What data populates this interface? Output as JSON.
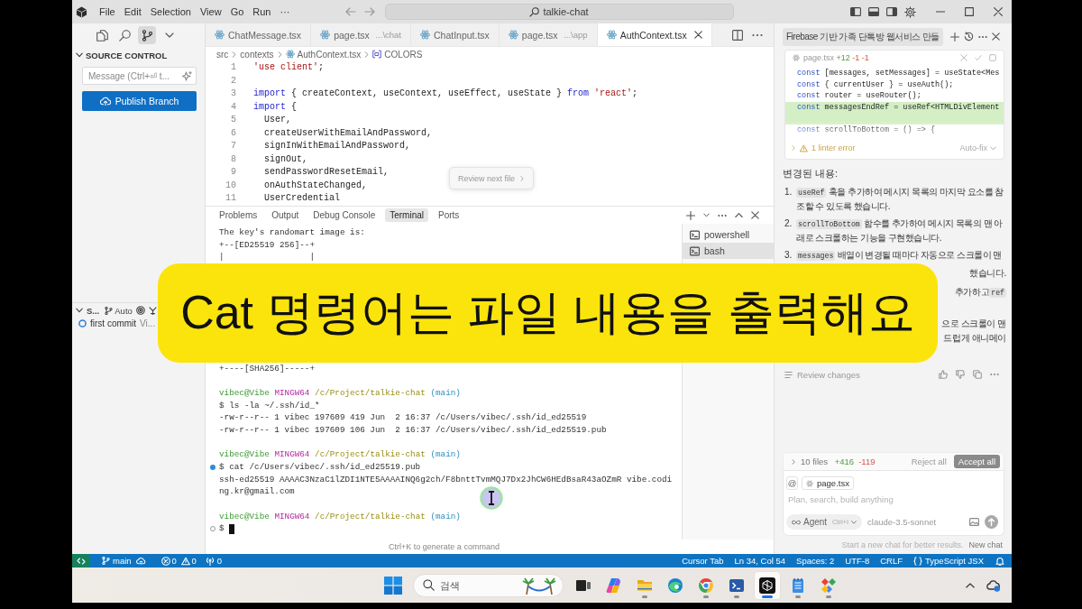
{
  "title_bar": {
    "menus": [
      "File",
      "Edit",
      "Selection",
      "View",
      "Go",
      "Run",
      "···"
    ],
    "search": "talkie-chat"
  },
  "sidebar": {
    "views": [
      {
        "kind": "explorer",
        "selected": false
      },
      {
        "kind": "search",
        "selected": false
      },
      {
        "kind": "source_control",
        "selected": true
      },
      {
        "kind": "more",
        "selected": false
      }
    ],
    "section_title": "SOURCE CONTROL",
    "message": {
      "placeholder": "Message (Ctrl+⏎ t..."
    },
    "publish_button": "Publish Branch",
    "graph": {
      "title": "S...",
      "mode": "Auto",
      "commits": [
        {
          "message": "first commit",
          "author": "Vi..."
        }
      ]
    }
  },
  "editor": {
    "tabs": [
      {
        "label": "ChatMessage.tsx",
        "selected": false
      },
      {
        "label": "page.tsx",
        "detail": "...\\chat",
        "selected": false
      },
      {
        "label": "ChatInput.tsx",
        "selected": false
      },
      {
        "label": "page.tsx",
        "detail": "...\\app",
        "selected": false
      },
      {
        "label": "AuthContext.tsx",
        "selected": true
      }
    ],
    "breadcrumb": [
      {
        "label": "src",
        "kind": "folder"
      },
      {
        "label": "contexts",
        "kind": "folder"
      },
      {
        "label": "AuthContext.tsx",
        "kind": "file"
      },
      {
        "label": "COLORS",
        "kind": "symbol"
      }
    ],
    "lines": [
      {
        "number": "1",
        "tokens": [
          {
            "kind": "string",
            "text": "'use client'"
          },
          {
            "kind": "plain",
            "text": ";"
          }
        ]
      },
      {
        "number": "2"
      },
      {
        "number": "3",
        "tokens": [
          {
            "kind": "keyword",
            "text": "import"
          },
          {
            "kind": "plain",
            "text": " { createContext, useContext, useEffect, useState } "
          },
          {
            "kind": "keyword",
            "text": "from"
          },
          {
            "kind": "string",
            "text": " 'react'"
          },
          {
            "kind": "plain",
            "text": ";"
          }
        ]
      },
      {
        "number": "4",
        "tokens": [
          {
            "kind": "keyword",
            "text": "import"
          },
          {
            "kind": "plain",
            "text": " {"
          }
        ]
      },
      {
        "number": "5",
        "tokens": [
          {
            "kind": "plain",
            "text": "  User,"
          }
        ]
      },
      {
        "number": "6",
        "tokens": [
          {
            "kind": "plain",
            "text": "  createUserWithEmailAndPassword,"
          }
        ]
      },
      {
        "number": "7",
        "tokens": [
          {
            "kind": "plain",
            "text": "  signInWithEmailAndPassword,"
          }
        ]
      },
      {
        "number": "8",
        "tokens": [
          {
            "kind": "plain",
            "text": "  signOut,"
          }
        ]
      },
      {
        "number": "9",
        "tokens": [
          {
            "kind": "plain",
            "text": "  sendPasswordResetEmail,"
          }
        ]
      },
      {
        "number": "10",
        "tokens": [
          {
            "kind": "plain",
            "text": "  onAuthStateChanged,"
          }
        ]
      },
      {
        "number": "11",
        "tokens": [
          {
            "kind": "plain",
            "text": "  UserCredential"
          }
        ]
      }
    ],
    "review_button": "Review next file"
  },
  "panel": {
    "tabs": [
      {
        "label": "Problems",
        "selected": false
      },
      {
        "label": "Output",
        "selected": false
      },
      {
        "label": "Debug Console",
        "selected": false
      },
      {
        "label": "Terminal",
        "selected": true
      },
      {
        "label": "Ports",
        "selected": false
      }
    ],
    "terminal": {
      "randomart": {
        "header": "The key's randomart image is:",
        "top": "+--[ED25519 256]--+",
        "rows": [
          "|                 |"
        ],
        "bottom": "+----[SHA256]-----+"
      },
      "sessions": [
        {
          "kind": "unmarked",
          "prompt": {
            "user": "vibec@Vibe",
            "shell": "MINGW64",
            "path": "/c/Project/talkie-chat",
            "branch": "(main)"
          },
          "command": "$ ls -la ~/.ssh/id_*",
          "output": [
            "-rw-r--r-- 1 vibec 197609 419 Jun  2 16:37 /c/Users/vibec/.ssh/id_ed25519",
            "-rw-r--r-- 1 vibec 197609 106 Jun  2 16:37 /c/Users/vibec/.ssh/id_ed25519.pub"
          ]
        },
        {
          "kind": "succeeded",
          "prompt": {
            "user": "vibec@Vibe",
            "shell": "MINGW64",
            "path": "/c/Project/talkie-chat",
            "branch": "(main)"
          },
          "command": "$ cat /c/Users/vibec/.ssh/id_ed25519.pub",
          "output": [
            "ssh-ed25519 AAAAC3NzaC1lZDI1NTE5AAAAINQ6g2ch/F8bnttTvmMQJ7Dx2JhCW6HEdBsaR43aOZmR vibe.codi",
            "ng.kr@gmail.com"
          ]
        },
        {
          "kind": "active",
          "prompt": {
            "user": "vibec@Vibe",
            "shell": "MINGW64",
            "path": "/c/Project/talkie-chat",
            "branch": "(main)"
          },
          "command": "$",
          "cursor": true
        }
      ]
    },
    "terminals": [
      {
        "label": "powershell",
        "selected": false
      },
      {
        "label": "bash",
        "selected": true
      }
    ],
    "hint": "Ctrl+K to generate a command"
  },
  "chat": {
    "title": "Firebase 기반 가족 단톡방 웹서비스 만들",
    "diff": {
      "file": "page.tsx",
      "stats": [
        {
          "kind": "added",
          "text": "+12"
        },
        {
          "kind": "removed",
          "text": "-1"
        },
        {
          "kind": "removed",
          "text": "-1"
        }
      ],
      "lines": [
        {
          "added": false,
          "tokens": [
            {
              "kind": "keyword",
              "text": "const"
            },
            {
              "kind": "plain",
              "text": " [messages, setMessages] = useState<Mes"
            }
          ]
        },
        {
          "added": false,
          "tokens": [
            {
              "kind": "keyword",
              "text": "const"
            },
            {
              "kind": "plain",
              "text": " { currentUser } = useAuth();"
            }
          ]
        },
        {
          "added": false,
          "tokens": [
            {
              "kind": "keyword",
              "text": "const"
            },
            {
              "kind": "plain",
              "text": " router = useRouter();"
            }
          ]
        },
        {
          "added": true,
          "tokens": [
            {
              "kind": "keyword",
              "text": "const"
            },
            {
              "kind": "plain",
              "text": " messagesEndRef = useRef<HTMLDivElement"
            }
          ]
        },
        {
          "added": false,
          "tokens": [
            {
              "kind": "keyword",
              "text": "const"
            },
            {
              "kind": "plain",
              "text": " scrollToBottom = () => {"
            }
          ]
        }
      ],
      "lint": "1 linter error",
      "fix": "Auto-fix"
    },
    "heading": "변경된 내용:",
    "items": [
      {
        "number": "1.",
        "code": "useRef",
        "text": "훅을 추가하여 메시지 목록의 마지막 요소를 참조할 수 있도록 했습니다."
      },
      {
        "number": "2.",
        "code": "scrollToBottom",
        "text": "함수를 추가하여 메시지 목록의 맨 아래로 스크롤하는 기능을 구현했습니다."
      },
      {
        "number": "3.",
        "code": "messages",
        "text": "배열이 변경될 때마다 자동으로 스크롤이 맨"
      }
    ],
    "partial_lines": [
      {
        "text": "했습니다."
      },
      {
        "text": "추가하고",
        "code": "ref"
      },
      {
        "text": "으로 스크롤이 맨"
      },
      {
        "text": "드럽게 애니메이"
      }
    ],
    "review": "Review changes",
    "summary": {
      "files": "10 files",
      "added": "+416",
      "removed": "-119"
    },
    "reject": "Reject all",
    "accept": "Accept all",
    "mention": "@",
    "context_file": "page.tsx",
    "input": {
      "placeholder": "Plan, search, build anything"
    },
    "mode": "Agent",
    "shortcut": "Ctrl+I",
    "model": "claude-3.5-sonnet",
    "footer": "Start a new chat for better results.",
    "new_chat": "New chat"
  },
  "status_bar": {
    "branch": "main",
    "errors": "0",
    "warnings": "0",
    "ports": "0",
    "items": [
      "Cursor Tab",
      "Ln 34, Col 54",
      "Spaces: 2",
      "UTF-8",
      "CRLF"
    ],
    "language": "TypeScript JSX"
  },
  "taskbar": {
    "search": {
      "placeholder": "검색"
    },
    "apps": [
      {
        "kind": "task_view",
        "running": false,
        "selected": false
      },
      {
        "kind": "copilot",
        "running": false,
        "selected": false
      },
      {
        "kind": "files",
        "running": true,
        "selected": false
      },
      {
        "kind": "edge",
        "running": false,
        "selected": false
      },
      {
        "kind": "chrome",
        "running": true,
        "selected": false
      },
      {
        "kind": "terminal",
        "running": true,
        "selected": false
      },
      {
        "kind": "cursor",
        "running": true,
        "selected": true
      },
      {
        "kind": "notepad",
        "running": true,
        "selected": false
      },
      {
        "kind": "diamonds",
        "running": true,
        "selected": false
      }
    ]
  },
  "caption": "Cat 명령어는 파일 내용을 출력해요"
}
